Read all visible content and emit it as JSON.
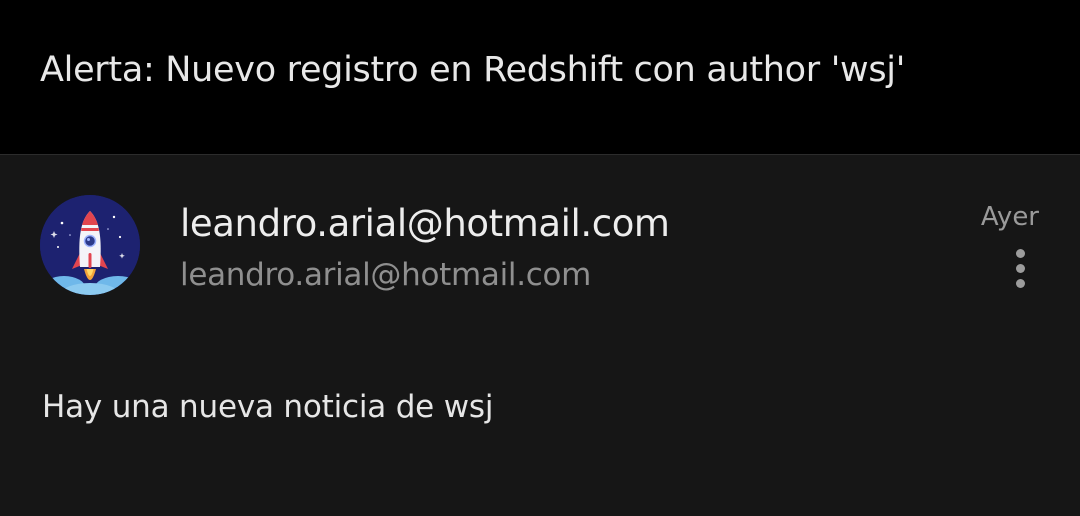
{
  "email": {
    "subject": "Alerta: Nuevo registro en Redshift con author 'wsj'",
    "sender": {
      "name": "leandro.arial@hotmail.com",
      "address": "leandro.arial@hotmail.com",
      "avatar_icon": "rocket-icon"
    },
    "date": "Ayer",
    "body": "Hay una nueva noticia de wsj",
    "more_icon": "more-vertical-icon"
  },
  "colors": {
    "header_bg": "#000000",
    "content_bg": "#161616",
    "primary_text": "#ededed",
    "secondary_text": "#8f8f8f",
    "avatar_bg": "#1d2270"
  }
}
